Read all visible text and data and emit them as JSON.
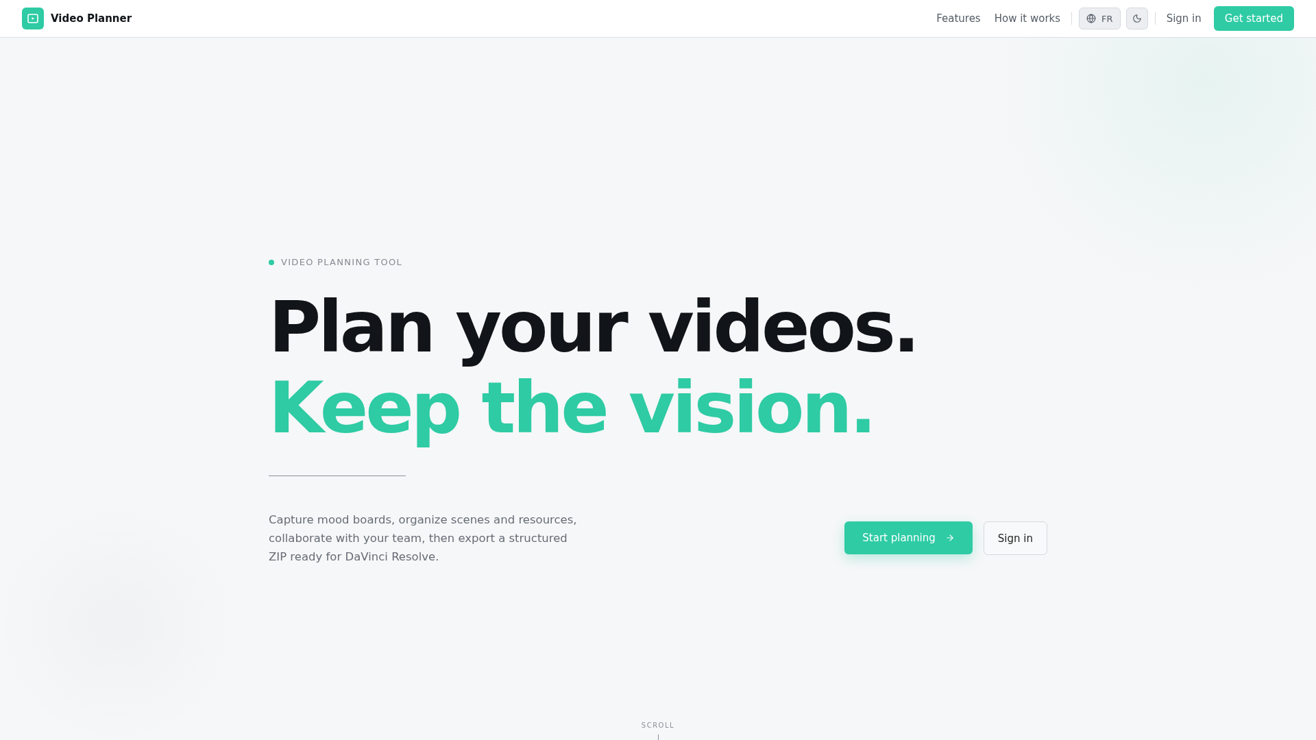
{
  "header": {
    "brand": "Video Planner",
    "nav": [
      "Features",
      "How it works"
    ],
    "language": "FR",
    "sign_in": "Sign in",
    "cta": "Get started"
  },
  "hero": {
    "eyebrow": "VIDEO PLANNING TOOL",
    "headline_1": "Plan your videos.",
    "headline_2": "Keep the vision.",
    "description": "Capture mood boards, organize scenes and resources, collaborate with your team, then export a structured ZIP ready for DaVinci Resolve.",
    "primary_button": "Start planning",
    "secondary_button": "Sign in"
  },
  "scroll_hint": "SCROLL"
}
